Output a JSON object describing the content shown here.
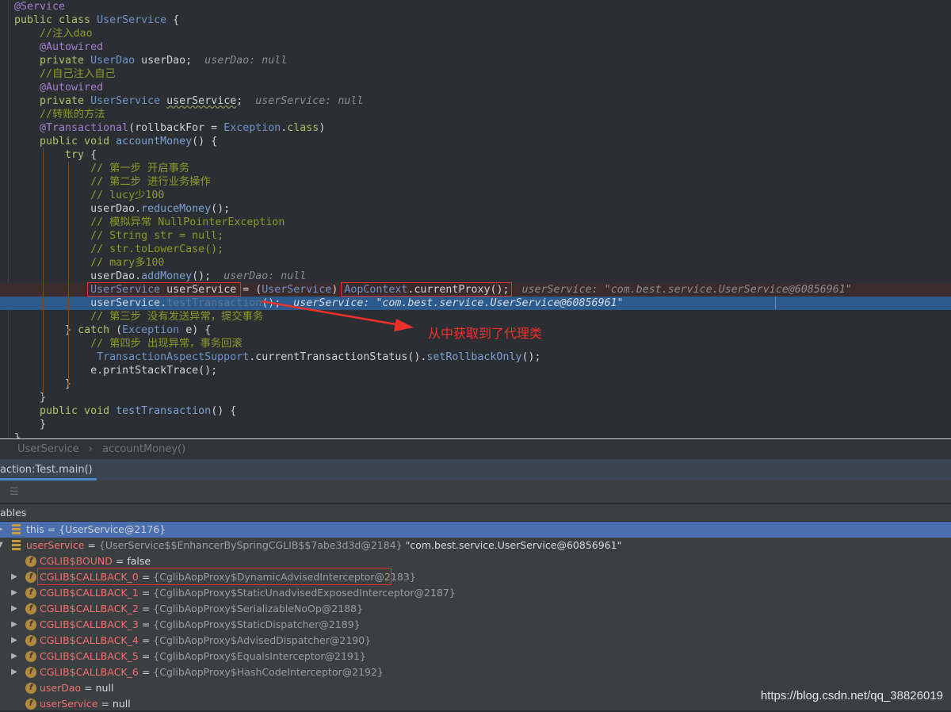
{
  "editor": {
    "lines": [
      [
        [
          "@Service",
          "a"
        ]
      ],
      [
        [
          "public class ",
          "k"
        ],
        [
          "UserService",
          "t"
        ],
        [
          " {",
          "n"
        ]
      ],
      [
        [
          "    //注入dao",
          "c"
        ]
      ],
      [
        [
          "    @Autowired",
          "a"
        ]
      ],
      [
        [
          "    private ",
          "k"
        ],
        [
          "UserDao ",
          "t"
        ],
        [
          "userDao;",
          "n"
        ],
        [
          "  userDao: null",
          "h"
        ]
      ],
      [
        [
          "    //自己注入自己",
          "c"
        ]
      ],
      [
        [
          "    @Autowired",
          "a"
        ]
      ],
      [
        [
          "    private ",
          "k"
        ],
        [
          "UserService ",
          "t"
        ],
        [
          "userService",
          "n w"
        ],
        [
          ";",
          "n"
        ],
        [
          "  userService: null",
          "h"
        ]
      ],
      [
        [
          "    //转账的方法",
          "c"
        ]
      ],
      [
        [
          "    @Transactional",
          "a"
        ],
        [
          "(rollbackFor = ",
          "n"
        ],
        [
          "Exception",
          "t"
        ],
        [
          ".",
          "n"
        ],
        [
          "class",
          "k"
        ],
        [
          ")",
          "n"
        ]
      ],
      [
        [
          "    public void ",
          "k"
        ],
        [
          "accountMoney",
          "m"
        ],
        [
          "() {",
          "n"
        ]
      ],
      [
        [
          "        try ",
          "k"
        ],
        [
          "{",
          "n"
        ]
      ],
      [
        [
          "            // 第一步 开启事务",
          "c"
        ]
      ],
      [
        [
          "            // 第二步 进行业务操作",
          "c"
        ]
      ],
      [
        [
          "            // lucy少100",
          "c"
        ]
      ],
      [
        [
          "            userDao.",
          "n"
        ],
        [
          "reduceMoney",
          "m"
        ],
        [
          "();",
          "n"
        ]
      ],
      [
        [
          "            // 模拟异常 NullPointerException",
          "c"
        ]
      ],
      [
        [
          "            // String str = null;",
          "c"
        ]
      ],
      [
        [
          "            // str.toLowerCase();",
          "c"
        ]
      ],
      [
        [
          "            // mary多100",
          "c"
        ]
      ],
      [
        [
          "            userDao.",
          "n"
        ],
        [
          "addMoney",
          "m"
        ],
        [
          "();",
          "n"
        ],
        [
          "  userDao: null",
          "h"
        ]
      ],
      [
        [
          "            ",
          "n"
        ],
        [
          "UserService ",
          "t"
        ],
        [
          "userService",
          "n"
        ],
        [
          " = (",
          "n"
        ],
        [
          "UserService",
          "t"
        ],
        [
          ") ",
          "n"
        ],
        [
          "AopContext",
          "t"
        ],
        [
          ".currentProxy();",
          "n"
        ],
        [
          "  userService: \"com.best.service.UserService@60856961\"",
          "h"
        ]
      ],
      [
        [
          "            userService.",
          "n"
        ],
        [
          "testTransaction",
          "g"
        ],
        [
          "();",
          "n"
        ],
        [
          "  userService: \"com.best.service.UserService@60856961\"",
          "h"
        ]
      ],
      [
        [
          "            // 第三步 没有发送异常，提交事务",
          "c"
        ]
      ],
      [
        [
          "        } ",
          "n"
        ],
        [
          "catch ",
          "k"
        ],
        [
          "(",
          "n"
        ],
        [
          "Exception ",
          "t"
        ],
        [
          "e) {",
          "n"
        ]
      ],
      [
        [
          "            // 第四步 出现异常，事务回滚",
          "c"
        ]
      ],
      [
        [
          "             ",
          "n"
        ],
        [
          "TransactionAspectSupport",
          "t"
        ],
        [
          ".currentTransactionStatus().",
          "n"
        ],
        [
          "setRollbackOnly",
          "m"
        ],
        [
          "();",
          "n"
        ]
      ],
      [
        [
          "            e.printStackTrace();",
          "n"
        ]
      ],
      [
        [
          "        }",
          "n"
        ]
      ],
      [
        [
          "    }",
          "n"
        ]
      ],
      [
        [
          "    public void ",
          "k"
        ],
        [
          "testTransaction",
          "m"
        ],
        [
          "() {",
          "n"
        ]
      ],
      [
        [
          "    }",
          "n"
        ]
      ],
      [
        [
          "}",
          "n"
        ]
      ]
    ]
  },
  "annotation": {
    "text": "从中获取到了代理类",
    "color": "#f0302a"
  },
  "breadcrumb": {
    "class": "UserService",
    "separator": "›",
    "method": "accountMoney()"
  },
  "debug_tab": {
    "label": "action:Test.main()",
    "close": "×"
  },
  "variables": {
    "header": "ables",
    "rows": [
      {
        "name": "this",
        "value": "{UserService@2176}",
        "icon": "list",
        "expand": "collapsed",
        "indent": 0,
        "selected": true
      },
      {
        "name": "userService",
        "value": "{UserService$$EnhancerBySpringCGLIB$$7abe3d3d@2184}",
        "extra": "\"com.best.service.UserService@60856961\"",
        "icon": "list",
        "expand": "expanded",
        "indent": 0
      },
      {
        "name": "CGLIB$BOUND",
        "value": "false",
        "icon": "field",
        "expand": "none",
        "indent": 1,
        "plainval": true
      },
      {
        "name": "CGLIB$CALLBACK_0",
        "value": "{CglibAopProxy$DynamicAdvisedInterceptor@2183}",
        "icon": "field",
        "expand": "collapsed",
        "indent": 1,
        "boxed": true
      },
      {
        "name": "CGLIB$CALLBACK_1",
        "value": "{CglibAopProxy$StaticUnadvisedExposedInterceptor@2187}",
        "icon": "field",
        "expand": "collapsed",
        "indent": 1
      },
      {
        "name": "CGLIB$CALLBACK_2",
        "value": "{CglibAopProxy$SerializableNoOp@2188}",
        "icon": "field",
        "expand": "collapsed",
        "indent": 1
      },
      {
        "name": "CGLIB$CALLBACK_3",
        "value": "{CglibAopProxy$StaticDispatcher@2189}",
        "icon": "field",
        "expand": "collapsed",
        "indent": 1
      },
      {
        "name": "CGLIB$CALLBACK_4",
        "value": "{CglibAopProxy$AdvisedDispatcher@2190}",
        "icon": "field",
        "expand": "collapsed",
        "indent": 1
      },
      {
        "name": "CGLIB$CALLBACK_5",
        "value": "{CglibAopProxy$EqualsInterceptor@2191}",
        "icon": "field",
        "expand": "collapsed",
        "indent": 1
      },
      {
        "name": "CGLIB$CALLBACK_6",
        "value": "{CglibAopProxy$HashCodeInterceptor@2192}",
        "icon": "field",
        "expand": "collapsed",
        "indent": 1
      },
      {
        "name": "userDao",
        "value": "null",
        "icon": "field",
        "expand": "none",
        "indent": 1,
        "plainval": true
      },
      {
        "name": "userService",
        "value": "null",
        "icon": "field",
        "expand": "none",
        "indent": 1,
        "plainval": true
      }
    ]
  },
  "watermark": "https://blog.csdn.net/qq_38826019"
}
